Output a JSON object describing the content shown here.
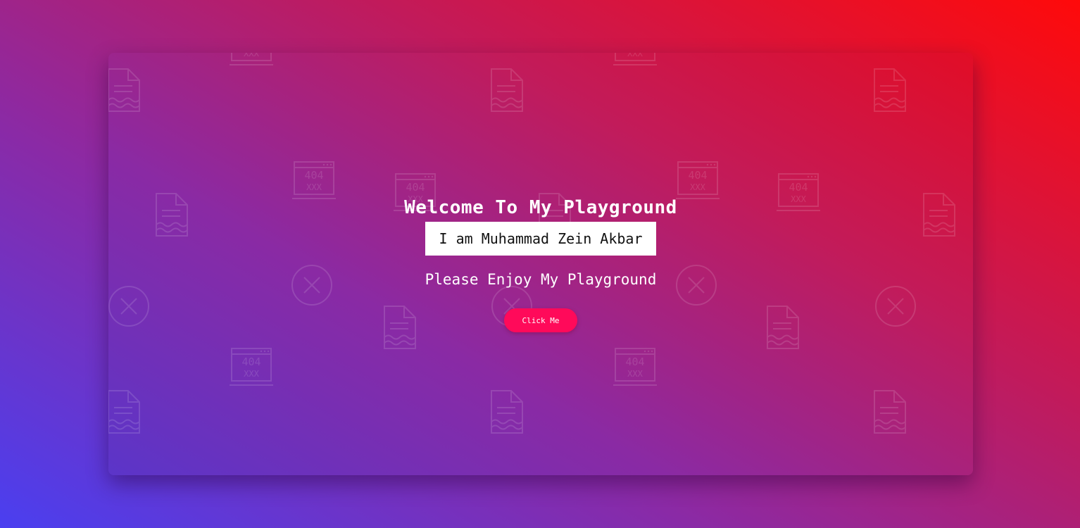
{
  "hero": {
    "title": "Welcome To My Playground",
    "name": "I am Muhammad Zein Akbar",
    "subtitle": "Please Enjoy My Playground",
    "button_label": "Click Me"
  },
  "pattern": {
    "error_code": "404",
    "error_marks": "XXX"
  },
  "colors": {
    "background_start": "#4a3ff0",
    "background_end": "#ff0a0a",
    "button": "#ff0a5a",
    "name_box": "#ffffff"
  },
  "icons": [
    "document-icon",
    "browser-404-icon",
    "circle-x-icon"
  ]
}
